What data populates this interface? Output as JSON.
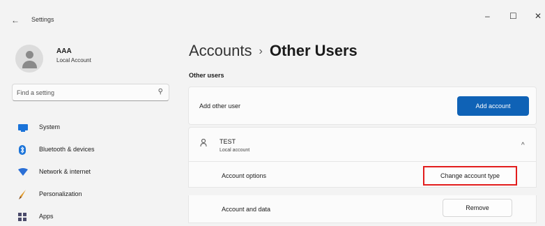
{
  "window": {
    "title": "Settings",
    "back_icon": "←",
    "minimize_icon": "–",
    "maximize_icon": "☐",
    "close_icon": "✕"
  },
  "profile": {
    "name": "AAA",
    "account_type": "Local Account"
  },
  "search": {
    "placeholder": "Find a setting",
    "icon": "⚲"
  },
  "nav": {
    "items": [
      {
        "label": "System",
        "icon": "system-icon",
        "color": "#1a73d9"
      },
      {
        "label": "Bluetooth & devices",
        "icon": "bluetooth-icon",
        "color": "#1a73d9"
      },
      {
        "label": "Network & internet",
        "icon": "network-icon",
        "color": "#2a6fd6"
      },
      {
        "label": "Personalization",
        "icon": "brush-icon",
        "color": "#e09a2b"
      },
      {
        "label": "Apps",
        "icon": "apps-icon",
        "color": "#4a4a6a"
      }
    ]
  },
  "header": {
    "parent": "Accounts",
    "separator": "›",
    "current": "Other Users"
  },
  "section": {
    "title": "Other users"
  },
  "add_user": {
    "label": "Add other user",
    "button": "Add account",
    "accent": "#0f62b6"
  },
  "user_card": {
    "name": "TEST",
    "type": "Local account",
    "chevron": "^"
  },
  "rows": [
    {
      "label": "Account options",
      "button": "Change account type",
      "highlight": "#e21c1c"
    },
    {
      "label": "Account and data",
      "button": "Remove"
    }
  ]
}
